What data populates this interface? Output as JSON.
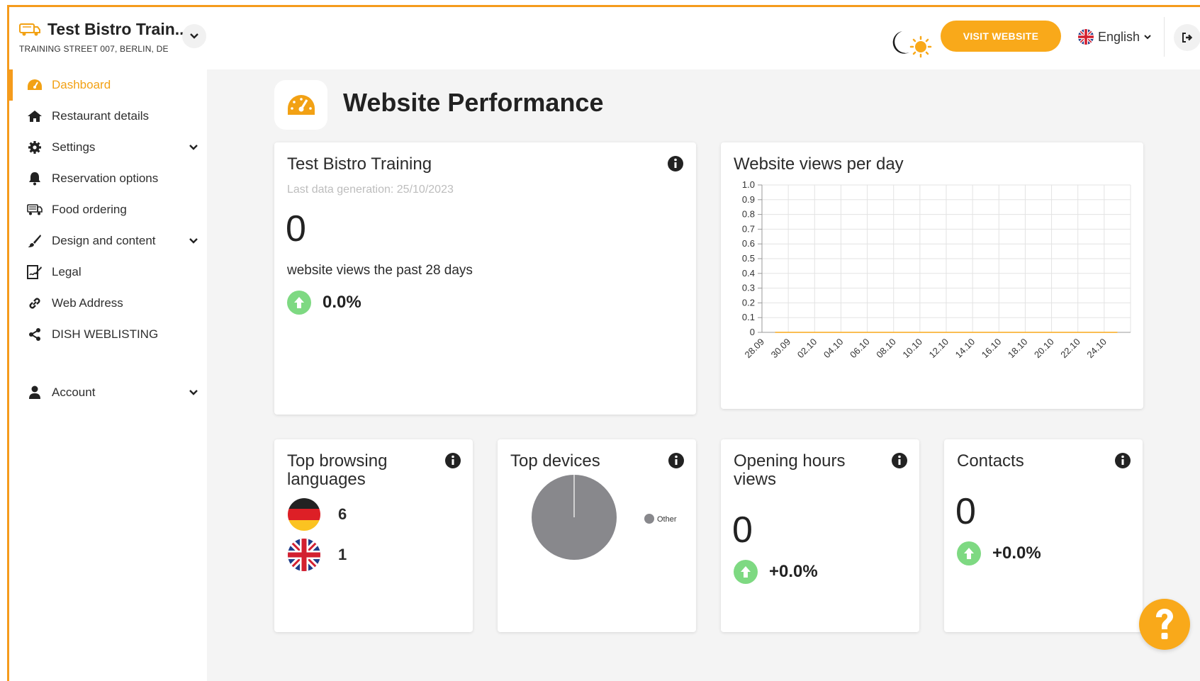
{
  "header": {
    "restaurant_name": "Test Bistro Train...",
    "address": "TRAINING STREET 007, BERLIN, DE",
    "visit_website_label": "VISIT WEBSITE",
    "language_label": "English"
  },
  "sidebar": {
    "items": [
      {
        "label": "Dashboard",
        "icon": "gauge-icon",
        "active": true
      },
      {
        "label": "Restaurant details",
        "icon": "home-icon"
      },
      {
        "label": "Settings",
        "icon": "gear-icon",
        "expandable": true
      },
      {
        "label": "Reservation options",
        "icon": "bell-icon"
      },
      {
        "label": "Food ordering",
        "icon": "food-truck-icon"
      },
      {
        "label": "Design and content",
        "icon": "brush-icon",
        "expandable": true
      },
      {
        "label": "Legal",
        "icon": "signature-icon"
      },
      {
        "label": "Web Address",
        "icon": "link-icon"
      },
      {
        "label": "DISH WEBLISTING",
        "icon": "share-icon"
      },
      {
        "label": "Account",
        "icon": "user-icon",
        "expandable": true
      }
    ]
  },
  "page": {
    "title": "Website Performance"
  },
  "summary_card": {
    "title": "Test Bistro Training",
    "last_generation": "Last data generation: 25/10/2023",
    "views": "0",
    "views_caption": "website views the past 28 days",
    "change": "0.0%"
  },
  "views_chart_card": {
    "title": "Website views per day"
  },
  "languages_card": {
    "title": "Top browsing languages",
    "languages": [
      {
        "flag": "germany-flag",
        "count": "6"
      },
      {
        "flag": "uk-flag",
        "count": "1"
      }
    ]
  },
  "devices_card": {
    "title": "Top devices",
    "legend": "Other"
  },
  "opening_hours_card": {
    "title": "Opening hours views",
    "value": "0",
    "change": "+0.0%"
  },
  "contacts_card": {
    "title": "Contacts",
    "value": "0",
    "change": "+0.0%"
  },
  "colors": {
    "accent": "#f9a91a",
    "up": "#7ed982",
    "pie": "#88888c"
  },
  "chart_data": [
    {
      "type": "line",
      "title": "Website views per day",
      "x": [
        "28.09",
        "30.09",
        "02.10",
        "04.10",
        "06.10",
        "08.10",
        "10.10",
        "12.10",
        "14.10",
        "16.10",
        "18.10",
        "20.10",
        "22.10",
        "24.10"
      ],
      "series": [
        {
          "values": [
            0,
            0,
            0,
            0,
            0,
            0,
            0,
            0,
            0,
            0,
            0,
            0,
            0,
            0
          ]
        }
      ],
      "y_ticks": [
        "0",
        "0.1",
        "0.2",
        "0.3",
        "0.4",
        "0.5",
        "0.6",
        "0.7",
        "0.8",
        "0.9",
        "1.0"
      ],
      "ylim": [
        0,
        1.0
      ],
      "grid": true
    },
    {
      "type": "pie",
      "title": "Top devices",
      "categories": [
        "Other"
      ],
      "values": [
        100
      ]
    }
  ]
}
